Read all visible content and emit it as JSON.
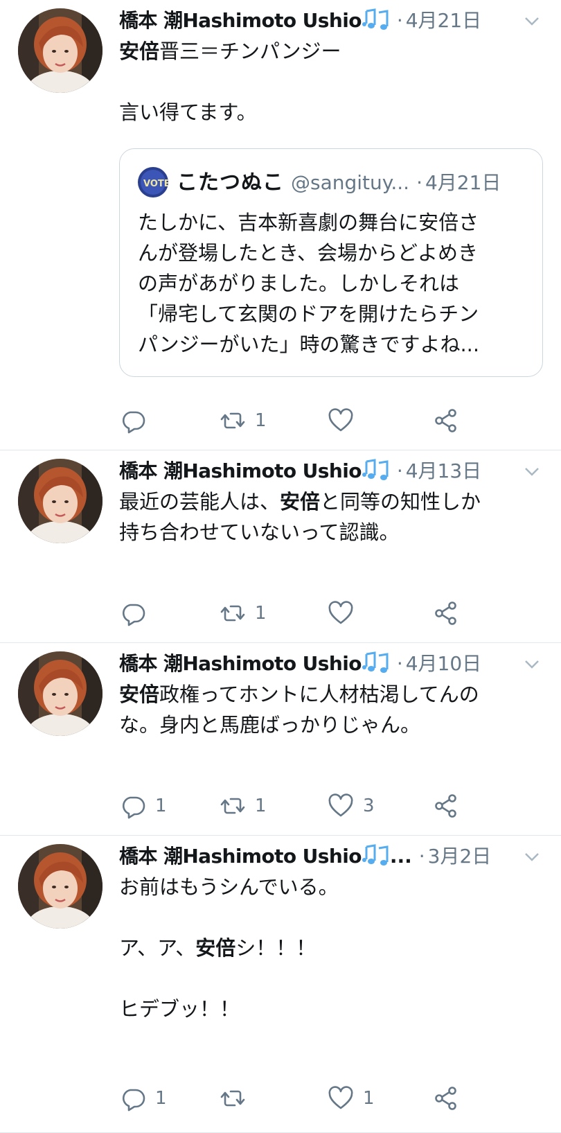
{
  "tweets": [
    {
      "author": "橋本 潮Hashimoto Ushio",
      "name_ellipsis": "",
      "dot": "·",
      "date": "4月21日",
      "lines": [
        [
          {
            "t": "安倍",
            "b": true
          },
          {
            "t": "晋三＝チンパンジー",
            "b": false
          }
        ],
        [],
        [
          {
            "t": "言い得てます。",
            "b": false
          }
        ]
      ],
      "quote": {
        "name": "こたつぬこ",
        "handle": "@sangituy...",
        "dot": "·",
        "date": "4月21日",
        "lines": [
          "たしかに、吉本新喜劇の舞台に安倍さ",
          "んが登場したとき、会場からどよめき",
          "の声があがりました。しかしそれは",
          "「帰宅して玄関のドアを開けたらチン",
          "パンジーがいた」時の驚きですよね..."
        ]
      },
      "actions": {
        "reply": "",
        "retweet": "1",
        "like": ""
      }
    },
    {
      "author": "橋本 潮Hashimoto Ushio",
      "name_ellipsis": "",
      "dot": "·",
      "date": "4月13日",
      "lines": [
        [
          {
            "t": "最近の芸能人は、",
            "b": false
          },
          {
            "t": "安倍",
            "b": true
          },
          {
            "t": "と同等の知性しか",
            "b": false
          }
        ],
        [
          {
            "t": "持ち合わせていないって認識。",
            "b": false
          }
        ]
      ],
      "actions": {
        "reply": "",
        "retweet": "1",
        "like": ""
      }
    },
    {
      "author": "橋本 潮Hashimoto Ushio",
      "name_ellipsis": "",
      "dot": "·",
      "date": "4月10日",
      "lines": [
        [
          {
            "t": "安倍",
            "b": true
          },
          {
            "t": "政権ってホントに人材枯渇してんの",
            "b": false
          }
        ],
        [
          {
            "t": "な。身内と馬鹿ばっかりじゃん。",
            "b": false
          }
        ]
      ],
      "actions": {
        "reply": "1",
        "retweet": "1",
        "like": "3"
      }
    },
    {
      "author": "橋本 潮Hashimoto Ushio",
      "name_ellipsis": "...",
      "dot": "·",
      "date": "3月2日",
      "lines": [
        [
          {
            "t": "お前はもうシんでいる。",
            "b": false
          }
        ],
        [],
        [
          {
            "t": "ア、ア、",
            "b": false
          },
          {
            "t": "安倍",
            "b": true
          },
          {
            "t": "シ！！！",
            "b": false
          }
        ],
        [],
        [
          {
            "t": "ヒデブッ！！",
            "b": false
          }
        ]
      ],
      "actions": {
        "reply": "1",
        "retweet": "",
        "like": "1"
      }
    }
  ],
  "icons": {
    "reply": "reply-icon",
    "retweet": "retweet-icon",
    "like": "heart-icon",
    "share": "share-icon",
    "caret": "chevron-down-icon",
    "name_emoji": "musical-notes-emoji-icon"
  },
  "colors": {
    "text": "#14171a",
    "secondary": "#657786",
    "border": "#e1e8ed",
    "emoji_blue": "#55acee"
  }
}
